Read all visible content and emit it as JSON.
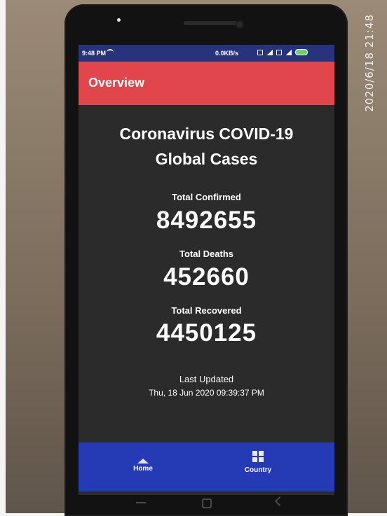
{
  "watermark": "2020/6/18  21:48",
  "status_bar": {
    "time": "9:48 PM",
    "network_speed": "0.0KB/s",
    "battery_color": "#6ad36a"
  },
  "app_bar": {
    "title": "Overview",
    "color": "#e0464c"
  },
  "overview": {
    "headline_line1": "Coronavirus COVID-19",
    "headline_line2": "Global Cases",
    "confirmed_label": "Total Confirmed",
    "confirmed_value": "8492655",
    "deaths_label": "Total Deaths",
    "deaths_value": "452660",
    "recovered_label": "Total Recovered",
    "recovered_value": "4450125",
    "last_updated_label": "Last Updated",
    "last_updated_value": "Thu, 18 Jun 2020 09:39:37 PM"
  },
  "bottom_nav": {
    "color": "#243bb5",
    "items": [
      {
        "label": "Home",
        "icon": "home-icon"
      },
      {
        "label": "Country",
        "icon": "grid-icon"
      }
    ]
  }
}
